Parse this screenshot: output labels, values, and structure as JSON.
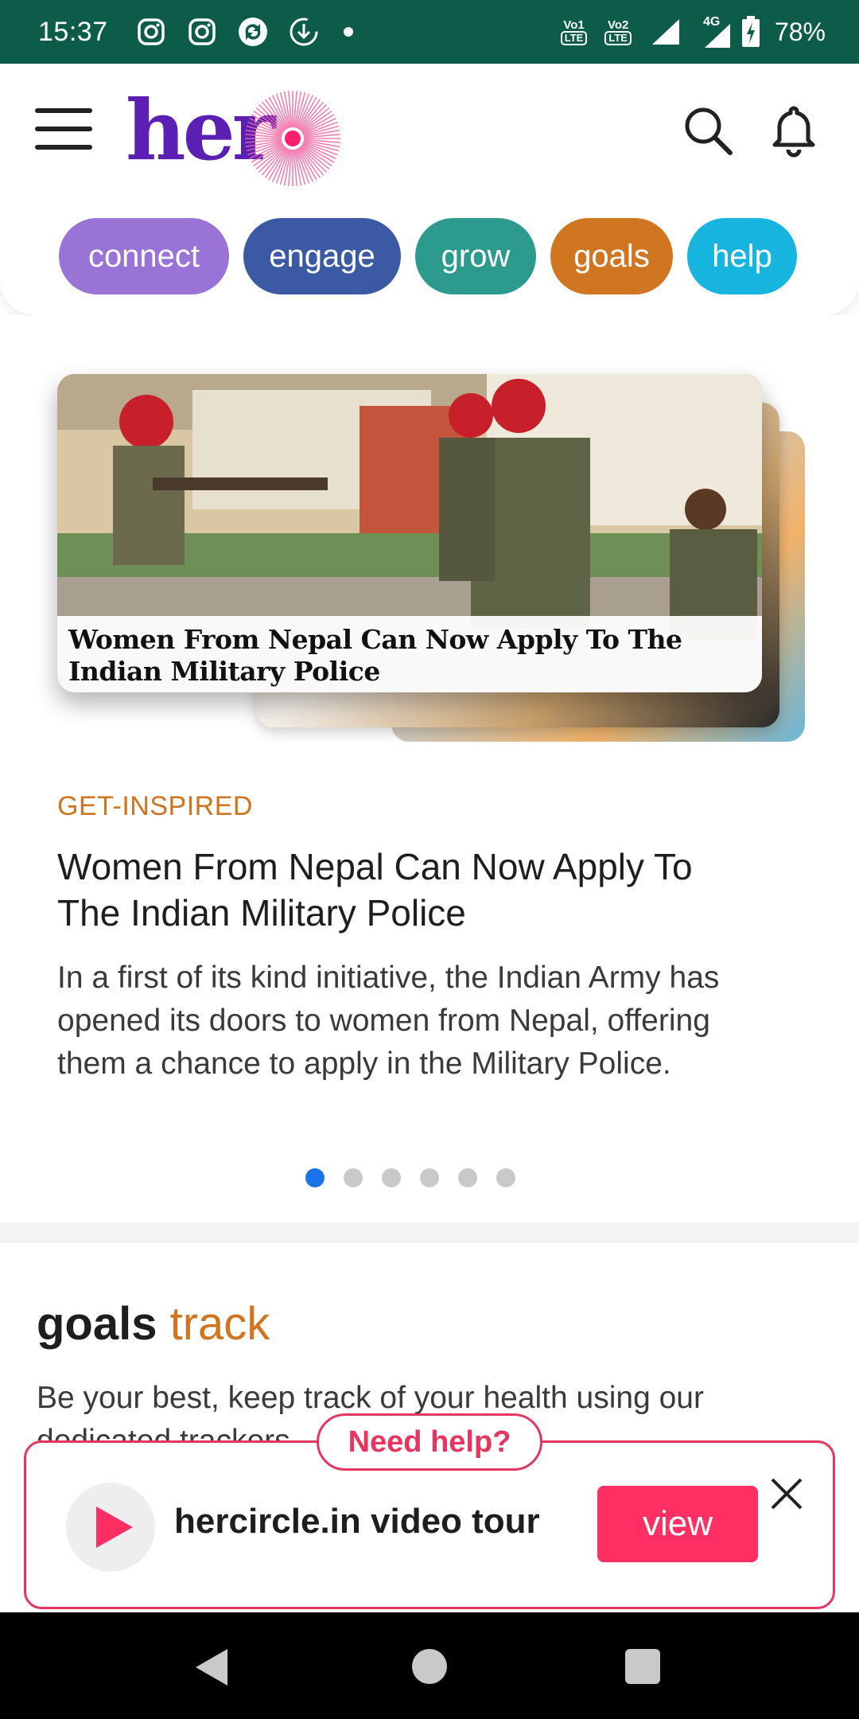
{
  "status_bar": {
    "time": "15:37",
    "icons": [
      "instagram-icon",
      "instagram-icon",
      "sync-icon",
      "download-icon",
      "dot-icon"
    ],
    "sim1": "VoLTE 1",
    "sim2": "VoLTE 2",
    "network": "4G",
    "battery": "78%"
  },
  "header": {
    "logo_text": "her",
    "categories": [
      {
        "label": "connect",
        "color": "#9a73d6"
      },
      {
        "label": "engage",
        "color": "#3b5aa3"
      },
      {
        "label": "grow",
        "color": "#2c9a8c"
      },
      {
        "label": "goals",
        "color": "#d17620"
      },
      {
        "label": "help",
        "color": "#17b4e0"
      }
    ]
  },
  "carousel": {
    "image_caption": "Women From Nepal Can Now Apply To The Indian Military Police",
    "category": "GET-INSPIRED",
    "headline": "Women From Nepal Can Now Apply To The Indian Military Police",
    "summary": "In a first of its kind initiative, the Indian Army has opened its doors to women from Nepal, offering them a chance to apply in the Military Police.",
    "total_slides": 6,
    "active_slide": 1
  },
  "goals": {
    "title": "goals",
    "title_accent": "track",
    "description": "Be your best, keep track of your health using our dedicated trackers"
  },
  "help_banner": {
    "badge": "Need help?",
    "label": "hercircle.in video tour",
    "button": "view"
  },
  "colors": {
    "status_bar": "#0d5c4a",
    "brand_purple": "#5b1fb3",
    "brand_pink": "#e8355f",
    "view_button": "#ff2e63",
    "accent_orange": "#d0741e",
    "active_dot": "#1a73e8"
  }
}
